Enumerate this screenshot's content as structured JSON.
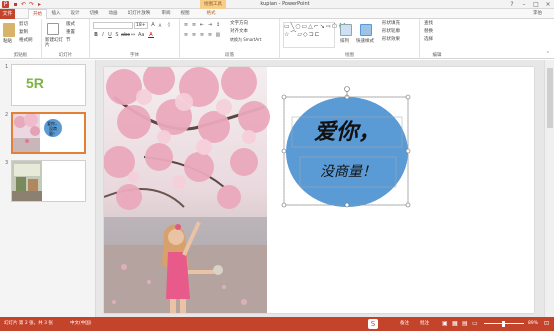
{
  "app": {
    "title": "kupian - PowerPoint",
    "context_tab_title": "绘图工具"
  },
  "quick_access": {
    "save_icon": "save-icon",
    "undo_icon": "undo-icon",
    "redo_icon": "redo-icon"
  },
  "tabs": {
    "file": "文件",
    "items": [
      "开始",
      "插入",
      "设计",
      "切换",
      "动画",
      "幻灯片放映",
      "审阅",
      "视图",
      "格式"
    ],
    "active": "开始",
    "user": "李伯"
  },
  "ribbon": {
    "clipboard": {
      "label": "剪贴板",
      "paste": "粘贴",
      "cut": "剪切",
      "copy": "复制",
      "format_painter": "格式刷"
    },
    "slides": {
      "label": "幻灯片",
      "new_slide": "新建幻灯片",
      "layout": "版式",
      "reset": "重置",
      "section": "节"
    },
    "font": {
      "label": "字体",
      "font_name": "",
      "font_size": "18+",
      "grow": "A",
      "shrink": "A"
    },
    "paragraph": {
      "label": "段落",
      "text_direction": "文字方向",
      "align_text": "对齐文本",
      "smartart": "转换为 SmartArt"
    },
    "drawing": {
      "label": "绘图",
      "arrange": "排列",
      "quick_styles": "快速样式",
      "shape_fill": "形状填充",
      "shape_outline": "形状轮廓",
      "shape_effects": "形状效果"
    },
    "editing": {
      "label": "编辑",
      "find": "查找",
      "replace": "替换",
      "select": "选择"
    }
  },
  "thumbnails": [
    {
      "num": "1",
      "logo_text": "5R"
    },
    {
      "num": "2",
      "caption": "爱你，没商量！"
    },
    {
      "num": "3"
    }
  ],
  "slide": {
    "shape_text_line1": "爱你，",
    "shape_text_line2": "没商量！",
    "shape_fill_color": "#5b9bd5"
  },
  "status": {
    "slide_info": "幻灯片 第 2 张，共 3 张",
    "language": "中文(中国)",
    "notes": "备注",
    "comments": "批注",
    "zoom": "89%"
  },
  "colors": {
    "accent": "#c4432b",
    "context_tab": "#f6ce8a"
  }
}
